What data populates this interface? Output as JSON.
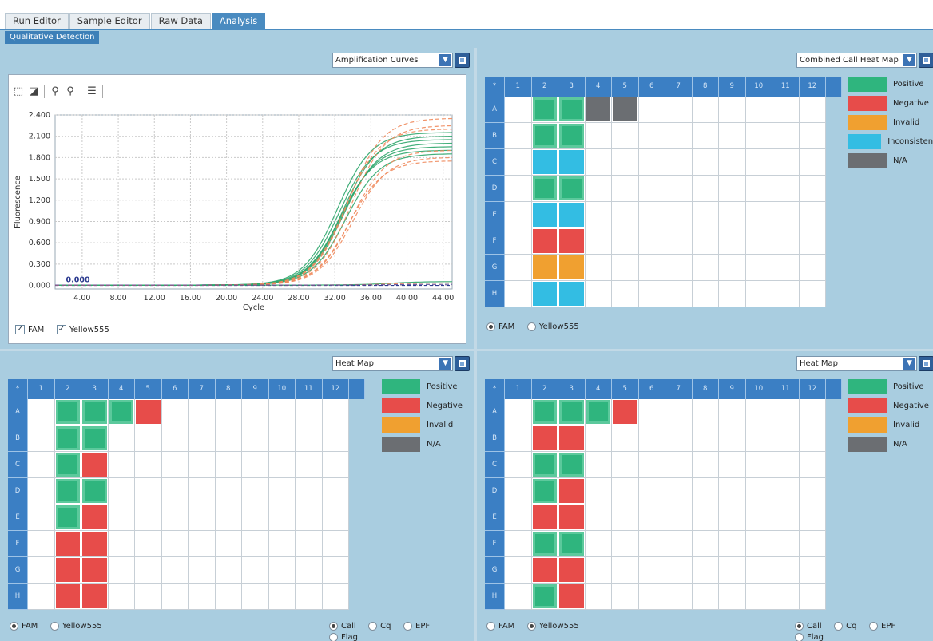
{
  "tabs": [
    {
      "label": "Run Editor",
      "active": false
    },
    {
      "label": "Sample Editor",
      "active": false
    },
    {
      "label": "Raw Data",
      "active": false
    },
    {
      "label": "Analysis",
      "active": true
    }
  ],
  "subtab": "Qualitative Detection",
  "colors": {
    "positive": "#2fb57e",
    "negative": "#e74c4a",
    "invalid": "#f0a030",
    "inconsistent": "#33bde3",
    "na": "#6b6e72",
    "header": "#3b7fc4"
  },
  "chart_panel": {
    "dropdown": "Amplification Curves",
    "checkboxes": [
      {
        "label": "FAM",
        "checked": true
      },
      {
        "label": "Yellow555",
        "checked": true
      }
    ]
  },
  "chart_data": {
    "type": "line",
    "xlabel": "Cycle",
    "ylabel": "Fluorescence",
    "xlim": [
      1,
      45
    ],
    "ylim": [
      -0.05,
      2.4
    ],
    "xticks": [
      "4.00",
      "8.00",
      "12.00",
      "16.00",
      "20.00",
      "24.00",
      "28.00",
      "32.00",
      "36.00",
      "40.00",
      "44.00"
    ],
    "yticks": [
      "0.000",
      "0.300",
      "0.600",
      "0.900",
      "1.200",
      "1.500",
      "1.800",
      "2.100",
      "2.400"
    ],
    "annotation": "0.000",
    "series": [
      {
        "color": "#2ea66b",
        "dashed": false,
        "plateau": 2.05,
        "midpoint": 32.5
      },
      {
        "color": "#2ea66b",
        "dashed": false,
        "plateau": 1.95,
        "midpoint": 32.8
      },
      {
        "color": "#2ea66b",
        "dashed": false,
        "plateau": 2.0,
        "midpoint": 33.0
      },
      {
        "color": "#2ea66b",
        "dashed": false,
        "plateau": 1.9,
        "midpoint": 32.6
      },
      {
        "color": "#2ea66b",
        "dashed": false,
        "plateau": 2.15,
        "midpoint": 32.3
      },
      {
        "color": "#2ea66b",
        "dashed": false,
        "plateau": 1.85,
        "midpoint": 33.2
      },
      {
        "color": "#2ea66b",
        "dashed": false,
        "plateau": 2.1,
        "midpoint": 32.9
      },
      {
        "color": "#2ea66b",
        "dashed": false,
        "plateau": 0.05,
        "midpoint": 38.0
      },
      {
        "color": "#ef8a5c",
        "dashed": true,
        "plateau": 2.35,
        "midpoint": 33.5
      },
      {
        "color": "#ef8a5c",
        "dashed": true,
        "plateau": 2.25,
        "midpoint": 33.8
      },
      {
        "color": "#ef8a5c",
        "dashed": true,
        "plateau": 1.75,
        "midpoint": 33.6
      },
      {
        "color": "#ef8a5c",
        "dashed": true,
        "plateau": 1.8,
        "midpoint": 34.0
      },
      {
        "color": "#ef8a5c",
        "dashed": true,
        "plateau": 2.2,
        "midpoint": 33.2
      },
      {
        "color": "#ef8a5c",
        "dashed": true,
        "plateau": 1.9,
        "midpoint": 33.9
      },
      {
        "color": "#ef8a5c",
        "dashed": true,
        "plateau": 0.03,
        "midpoint": 38.0
      },
      {
        "color": "#5a4a9a",
        "dashed": true,
        "plateau": 0.01,
        "midpoint": 38.0
      }
    ]
  },
  "plate_cols": [
    "1",
    "2",
    "3",
    "4",
    "5",
    "6",
    "7",
    "8",
    "9",
    "10",
    "11",
    "12"
  ],
  "plate_rows": [
    "A",
    "B",
    "C",
    "D",
    "E",
    "F",
    "G",
    "H"
  ],
  "combined_panel": {
    "dropdown": "Combined Call Heat Map",
    "legend": [
      {
        "label": "Positive",
        "color": "positive"
      },
      {
        "label": "Negative",
        "color": "negative"
      },
      {
        "label": "Invalid",
        "color": "invalid"
      },
      {
        "label": "Inconsistent",
        "color": "inconsistent"
      },
      {
        "label": "N/A",
        "color": "na"
      }
    ],
    "cells": {
      "A2": "positive",
      "A3": "positive",
      "A4": "na",
      "A5": "na",
      "B2": "positive",
      "B3": "positive",
      "C2": "inconsistent",
      "C3": "inconsistent",
      "D2": "positive",
      "D3": "positive",
      "E2": "inconsistent",
      "E3": "inconsistent",
      "F2": "negative",
      "F3": "negative",
      "G2": "invalid",
      "G3": "invalid",
      "H2": "inconsistent",
      "H3": "inconsistent"
    },
    "radios": [
      {
        "label": "FAM",
        "on": true
      },
      {
        "label": "Yellow555",
        "on": false
      }
    ]
  },
  "heat_left": {
    "dropdown": "Heat Map",
    "legend": [
      {
        "label": "Positive",
        "color": "positive"
      },
      {
        "label": "Negative",
        "color": "negative"
      },
      {
        "label": "Invalid",
        "color": "invalid"
      },
      {
        "label": "N/A",
        "color": "na"
      }
    ],
    "cells": {
      "A2": "positive",
      "A3": "positive",
      "A4": "positive",
      "A5": "negative",
      "B2": "positive",
      "B3": "positive",
      "C2": "positive",
      "C3": "negative",
      "D2": "positive",
      "D3": "positive",
      "E2": "positive",
      "E3": "negative",
      "F2": "negative",
      "F3": "negative",
      "G2": "negative",
      "G3": "negative",
      "H2": "negative",
      "H3": "negative"
    },
    "radios": [
      {
        "label": "FAM",
        "on": true
      },
      {
        "label": "Yellow555",
        "on": false
      }
    ],
    "radios2": [
      {
        "label": "Call",
        "on": true
      },
      {
        "label": "Cq",
        "on": false
      },
      {
        "label": "EPF",
        "on": false
      },
      {
        "label": "Flag",
        "on": false
      }
    ]
  },
  "heat_right": {
    "dropdown": "Heat Map",
    "legend": [
      {
        "label": "Positive",
        "color": "positive"
      },
      {
        "label": "Negative",
        "color": "negative"
      },
      {
        "label": "Invalid",
        "color": "invalid"
      },
      {
        "label": "N/A",
        "color": "na"
      }
    ],
    "cells": {
      "A2": "positive",
      "A3": "positive",
      "A4": "positive",
      "A5": "negative",
      "B2": "negative",
      "B3": "negative",
      "C2": "positive",
      "C3": "positive",
      "D2": "positive",
      "D3": "negative",
      "E2": "negative",
      "E3": "negative",
      "F2": "positive",
      "F3": "positive",
      "G2": "negative",
      "G3": "negative",
      "H2": "positive",
      "H3": "negative"
    },
    "radios": [
      {
        "label": "FAM",
        "on": false
      },
      {
        "label": "Yellow555",
        "on": true
      }
    ],
    "radios2": [
      {
        "label": "Call",
        "on": true
      },
      {
        "label": "Cq",
        "on": false
      },
      {
        "label": "EPF",
        "on": false
      },
      {
        "label": "Flag",
        "on": false
      }
    ]
  }
}
